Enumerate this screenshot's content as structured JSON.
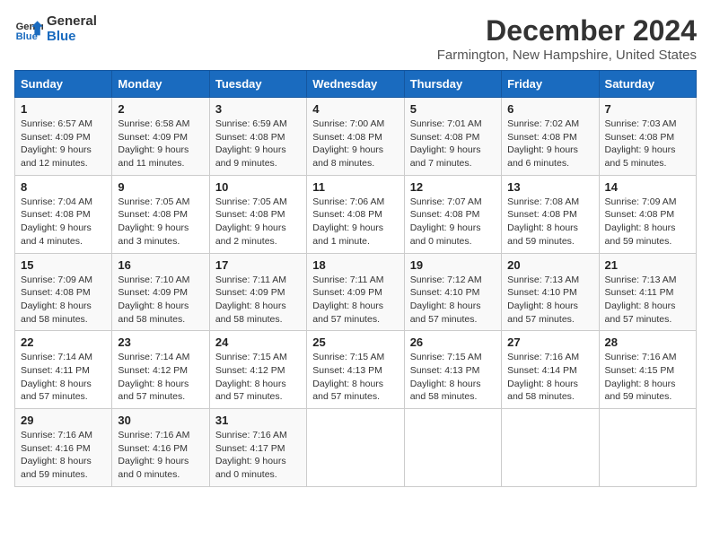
{
  "header": {
    "logo_line1": "General",
    "logo_line2": "Blue",
    "month": "December 2024",
    "location": "Farmington, New Hampshire, United States"
  },
  "weekdays": [
    "Sunday",
    "Monday",
    "Tuesday",
    "Wednesday",
    "Thursday",
    "Friday",
    "Saturday"
  ],
  "weeks": [
    [
      {
        "day": "1",
        "sunrise": "6:57 AM",
        "sunset": "4:09 PM",
        "daylight": "9 hours and 12 minutes."
      },
      {
        "day": "2",
        "sunrise": "6:58 AM",
        "sunset": "4:09 PM",
        "daylight": "9 hours and 11 minutes."
      },
      {
        "day": "3",
        "sunrise": "6:59 AM",
        "sunset": "4:08 PM",
        "daylight": "9 hours and 9 minutes."
      },
      {
        "day": "4",
        "sunrise": "7:00 AM",
        "sunset": "4:08 PM",
        "daylight": "9 hours and 8 minutes."
      },
      {
        "day": "5",
        "sunrise": "7:01 AM",
        "sunset": "4:08 PM",
        "daylight": "9 hours and 7 minutes."
      },
      {
        "day": "6",
        "sunrise": "7:02 AM",
        "sunset": "4:08 PM",
        "daylight": "9 hours and 6 minutes."
      },
      {
        "day": "7",
        "sunrise": "7:03 AM",
        "sunset": "4:08 PM",
        "daylight": "9 hours and 5 minutes."
      }
    ],
    [
      {
        "day": "8",
        "sunrise": "7:04 AM",
        "sunset": "4:08 PM",
        "daylight": "9 hours and 4 minutes."
      },
      {
        "day": "9",
        "sunrise": "7:05 AM",
        "sunset": "4:08 PM",
        "daylight": "9 hours and 3 minutes."
      },
      {
        "day": "10",
        "sunrise": "7:05 AM",
        "sunset": "4:08 PM",
        "daylight": "9 hours and 2 minutes."
      },
      {
        "day": "11",
        "sunrise": "7:06 AM",
        "sunset": "4:08 PM",
        "daylight": "9 hours and 1 minute."
      },
      {
        "day": "12",
        "sunrise": "7:07 AM",
        "sunset": "4:08 PM",
        "daylight": "9 hours and 0 minutes."
      },
      {
        "day": "13",
        "sunrise": "7:08 AM",
        "sunset": "4:08 PM",
        "daylight": "8 hours and 59 minutes."
      },
      {
        "day": "14",
        "sunrise": "7:09 AM",
        "sunset": "4:08 PM",
        "daylight": "8 hours and 59 minutes."
      }
    ],
    [
      {
        "day": "15",
        "sunrise": "7:09 AM",
        "sunset": "4:08 PM",
        "daylight": "8 hours and 58 minutes."
      },
      {
        "day": "16",
        "sunrise": "7:10 AM",
        "sunset": "4:09 PM",
        "daylight": "8 hours and 58 minutes."
      },
      {
        "day": "17",
        "sunrise": "7:11 AM",
        "sunset": "4:09 PM",
        "daylight": "8 hours and 58 minutes."
      },
      {
        "day": "18",
        "sunrise": "7:11 AM",
        "sunset": "4:09 PM",
        "daylight": "8 hours and 57 minutes."
      },
      {
        "day": "19",
        "sunrise": "7:12 AM",
        "sunset": "4:10 PM",
        "daylight": "8 hours and 57 minutes."
      },
      {
        "day": "20",
        "sunrise": "7:13 AM",
        "sunset": "4:10 PM",
        "daylight": "8 hours and 57 minutes."
      },
      {
        "day": "21",
        "sunrise": "7:13 AM",
        "sunset": "4:11 PM",
        "daylight": "8 hours and 57 minutes."
      }
    ],
    [
      {
        "day": "22",
        "sunrise": "7:14 AM",
        "sunset": "4:11 PM",
        "daylight": "8 hours and 57 minutes."
      },
      {
        "day": "23",
        "sunrise": "7:14 AM",
        "sunset": "4:12 PM",
        "daylight": "8 hours and 57 minutes."
      },
      {
        "day": "24",
        "sunrise": "7:15 AM",
        "sunset": "4:12 PM",
        "daylight": "8 hours and 57 minutes."
      },
      {
        "day": "25",
        "sunrise": "7:15 AM",
        "sunset": "4:13 PM",
        "daylight": "8 hours and 57 minutes."
      },
      {
        "day": "26",
        "sunrise": "7:15 AM",
        "sunset": "4:13 PM",
        "daylight": "8 hours and 58 minutes."
      },
      {
        "day": "27",
        "sunrise": "7:16 AM",
        "sunset": "4:14 PM",
        "daylight": "8 hours and 58 minutes."
      },
      {
        "day": "28",
        "sunrise": "7:16 AM",
        "sunset": "4:15 PM",
        "daylight": "8 hours and 59 minutes."
      }
    ],
    [
      {
        "day": "29",
        "sunrise": "7:16 AM",
        "sunset": "4:16 PM",
        "daylight": "8 hours and 59 minutes."
      },
      {
        "day": "30",
        "sunrise": "7:16 AM",
        "sunset": "4:16 PM",
        "daylight": "9 hours and 0 minutes."
      },
      {
        "day": "31",
        "sunrise": "7:16 AM",
        "sunset": "4:17 PM",
        "daylight": "9 hours and 0 minutes."
      },
      null,
      null,
      null,
      null
    ]
  ],
  "labels": {
    "sunrise": "Sunrise:",
    "sunset": "Sunset:",
    "daylight": "Daylight:"
  }
}
